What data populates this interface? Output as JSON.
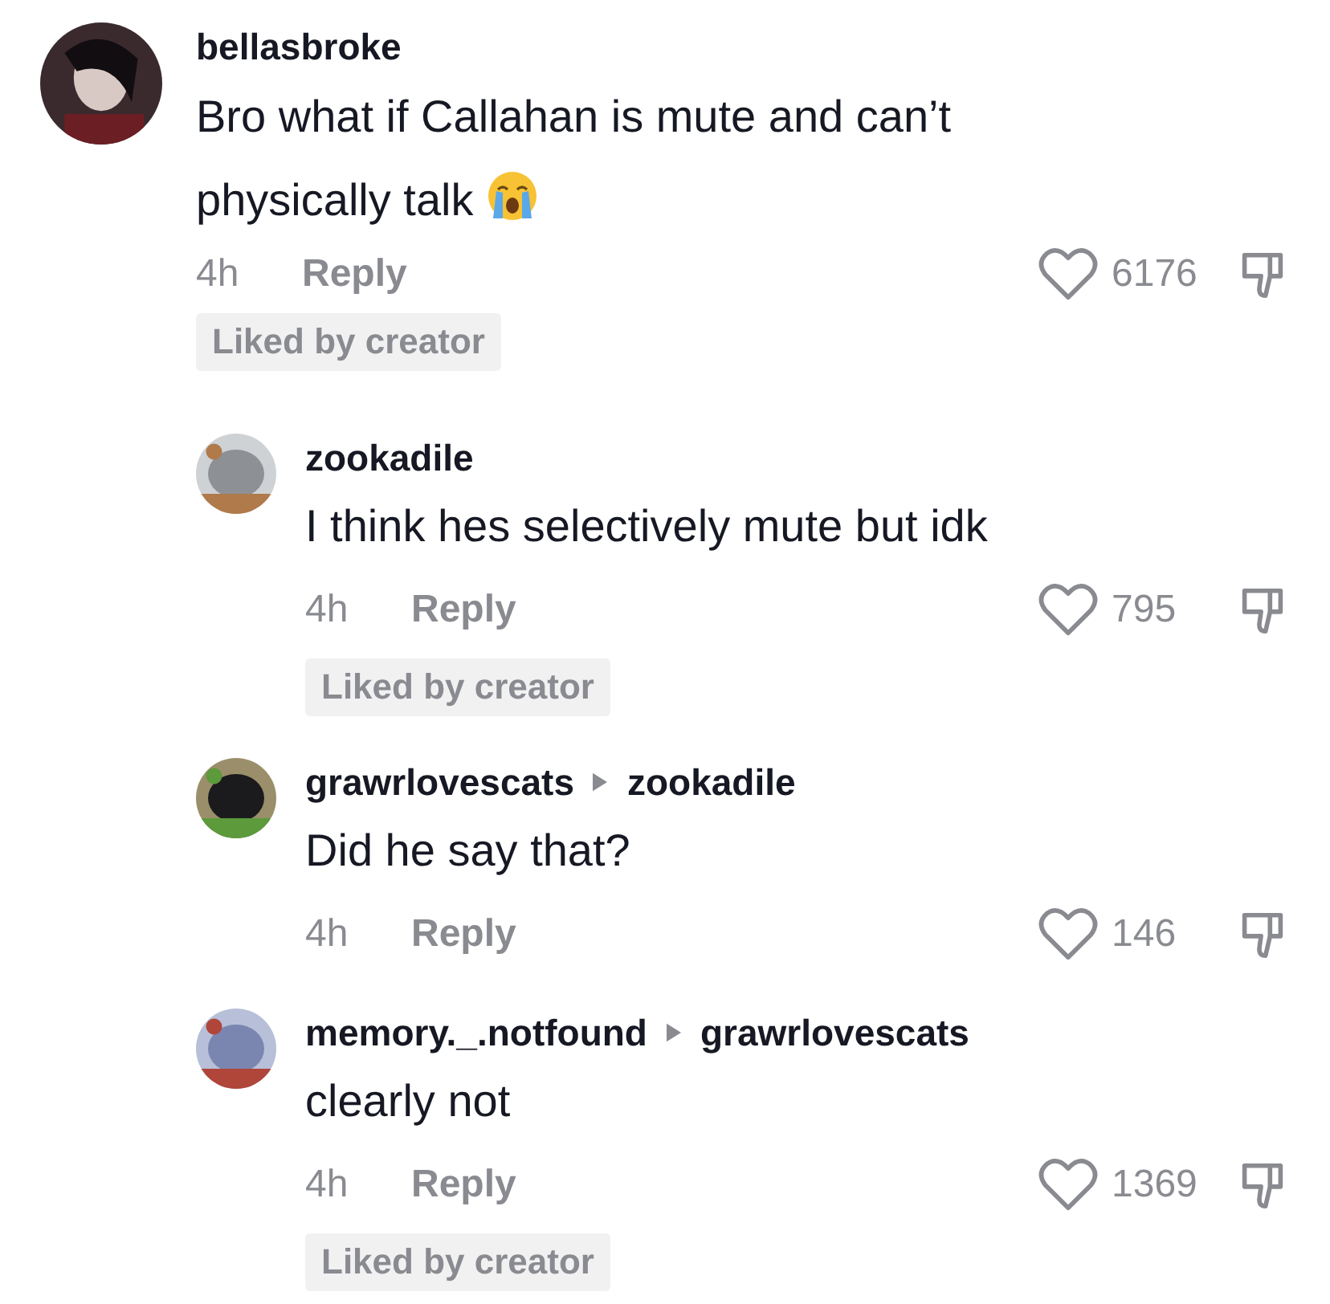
{
  "comments": [
    {
      "username": "bellasbroke",
      "text": "Bro what if Callahan is mute and can’t physically talk",
      "has_emoji": true,
      "time": "4h",
      "reply_label": "Reply",
      "likes": "6176",
      "badge": "Liked by creator",
      "replies": [
        {
          "username": "zookadile",
          "text": "I think hes selectively mute but idk",
          "time": "4h",
          "reply_label": "Reply",
          "likes": "795",
          "badge": "Liked by creator"
        },
        {
          "username": "grawrlovescats",
          "reply_to": "zookadile",
          "text": "Did he say that?",
          "time": "4h",
          "reply_label": "Reply",
          "likes": "146"
        },
        {
          "username": "memory._.notfound",
          "reply_to": "grawrlovescats",
          "text": "clearly not",
          "time": "4h",
          "reply_label": "Reply",
          "likes": "1369",
          "badge": "Liked by creator"
        }
      ]
    }
  ]
}
